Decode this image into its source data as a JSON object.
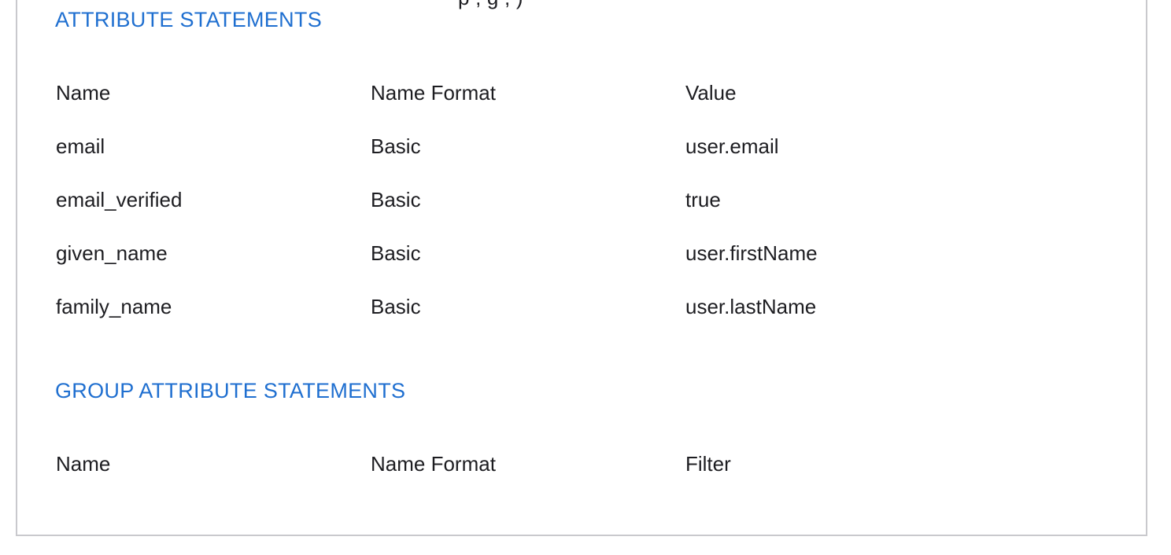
{
  "header_fragment": "p                                      ,  g  ,      )",
  "attribute_statements": {
    "title": "ATTRIBUTE STATEMENTS",
    "columns": [
      "Name",
      "Name Format",
      "Value"
    ],
    "rows": [
      {
        "name": "email",
        "format": "Basic",
        "value": "user.email"
      },
      {
        "name": "email_verified",
        "format": "Basic",
        "value": "true"
      },
      {
        "name": "given_name",
        "format": "Basic",
        "value": "user.firstName"
      },
      {
        "name": "family_name",
        "format": "Basic",
        "value": "user.lastName"
      }
    ]
  },
  "group_attribute_statements": {
    "title": "GROUP ATTRIBUTE STATEMENTS",
    "columns": [
      "Name",
      "Name Format",
      "Filter"
    ]
  },
  "colors": {
    "section_title": "#1f6fd0",
    "text": "#1d1d21",
    "border": "#c9c9cd"
  }
}
